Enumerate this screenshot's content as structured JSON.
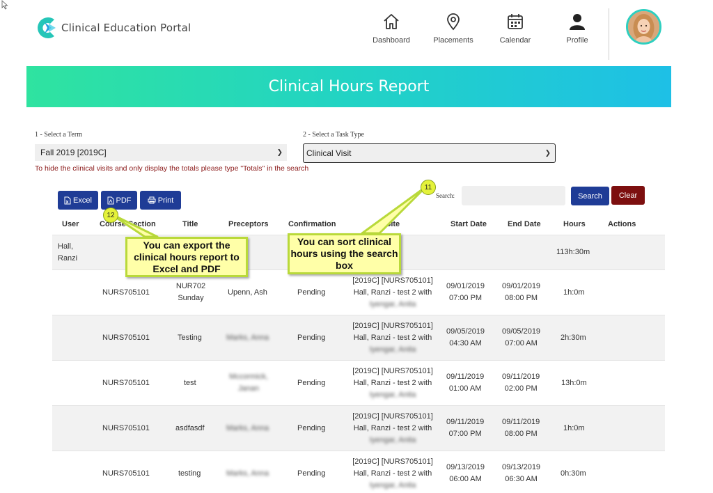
{
  "header": {
    "app_title": "Clinical Education Portal",
    "nav": [
      {
        "label": "Dashboard",
        "icon": "home-icon"
      },
      {
        "label": "Placements",
        "icon": "map-pin-icon"
      },
      {
        "label": "Calendar",
        "icon": "calendar-icon"
      },
      {
        "label": "Profile",
        "icon": "user-icon"
      }
    ]
  },
  "banner": {
    "title": "Clinical Hours Report"
  },
  "filters": {
    "term_label": "1 - Select a Term",
    "term_value": "Fall 2019 [2019C]",
    "task_label": "2 - Select a Task Type",
    "task_value": "Clinical Visit",
    "hint": "To hide the clinical visits and only display the totals please type \"Totals\" in the search"
  },
  "toolbar": {
    "excel": "Excel",
    "pdf": "PDF",
    "print": "Print",
    "search_label": "Search:",
    "search_button": "Search",
    "clear_button": "Clear"
  },
  "table": {
    "columns": [
      "User",
      "Course Section",
      "Title",
      "Preceptors",
      "Confirmation",
      "Site",
      "Start Date",
      "End Date",
      "Hours",
      "Actions"
    ],
    "summary": {
      "user_line1": "Hall,",
      "user_line2": "Ranzi",
      "hours": "113h:30m"
    },
    "rows": [
      {
        "course": "NURS705101",
        "title1": "NUR702",
        "title2": "Sunday",
        "preceptor1": "Upenn, Ash",
        "preceptor2": "",
        "preceptor_blurred": false,
        "confirmation": "Pending",
        "site1": "[2019C] [NURS705101]",
        "site2": "Hall, Ranzi - test 2 with",
        "site3": "Iyengar, Anita",
        "start1": "09/01/2019",
        "start2": "07:00 PM",
        "end1": "09/01/2019",
        "end2": "08:00 PM",
        "hours": "1h:0m"
      },
      {
        "course": "NURS705101",
        "title1": "Testing",
        "title2": "",
        "preceptor1": "Marks, Anna",
        "preceptor2": "",
        "preceptor_blurred": true,
        "confirmation": "Pending",
        "site1": "[2019C] [NURS705101]",
        "site2": "Hall, Ranzi - test 2 with",
        "site3": "Iyengar, Anita",
        "start1": "09/05/2019",
        "start2": "04:30 AM",
        "end1": "09/05/2019",
        "end2": "07:00 AM",
        "hours": "2h:30m"
      },
      {
        "course": "NURS705101",
        "title1": "test",
        "title2": "",
        "preceptor1": "Mccormick,",
        "preceptor2": "Janan",
        "preceptor_blurred": true,
        "confirmation": "Pending",
        "site1": "[2019C] [NURS705101]",
        "site2": "Hall, Ranzi - test 2 with",
        "site3": "Iyengar, Anita",
        "start1": "09/11/2019",
        "start2": "01:00 AM",
        "end1": "09/11/2019",
        "end2": "02:00 PM",
        "hours": "13h:0m"
      },
      {
        "course": "NURS705101",
        "title1": "asdfasdf",
        "title2": "",
        "preceptor1": "Marks, Anna",
        "preceptor2": "",
        "preceptor_blurred": true,
        "confirmation": "Pending",
        "site1": "[2019C] [NURS705101]",
        "site2": "Hall, Ranzi - test 2 with",
        "site3": "Iyengar, Anita",
        "start1": "09/11/2019",
        "start2": "07:00 PM",
        "end1": "09/11/2019",
        "end2": "08:00 PM",
        "hours": "1h:0m"
      },
      {
        "course": "NURS705101",
        "title1": "testing",
        "title2": "",
        "preceptor1": "Marks, Anna",
        "preceptor2": "",
        "preceptor_blurred": true,
        "confirmation": "Pending",
        "site1": "[2019C] [NURS705101]",
        "site2": "Hall, Ranzi - test 2 with",
        "site3": "Iyengar, Anita",
        "start1": "09/13/2019",
        "start2": "06:00 AM",
        "end1": "09/13/2019",
        "end2": "06:30 AM",
        "hours": "0h:30m"
      }
    ]
  },
  "callouts": {
    "export": {
      "badge": "12",
      "text": "You can export the clinical hours report to Excel and PDF"
    },
    "search": {
      "badge": "11",
      "text": "You can sort clinical hours using the search box"
    }
  },
  "colors": {
    "accent_blue": "#1f3c96",
    "clear_red": "#7d0f0f",
    "banner_start": "#2fe3a0",
    "banner_end": "#1ec0e6",
    "callout_bg": "#ffffa8"
  }
}
